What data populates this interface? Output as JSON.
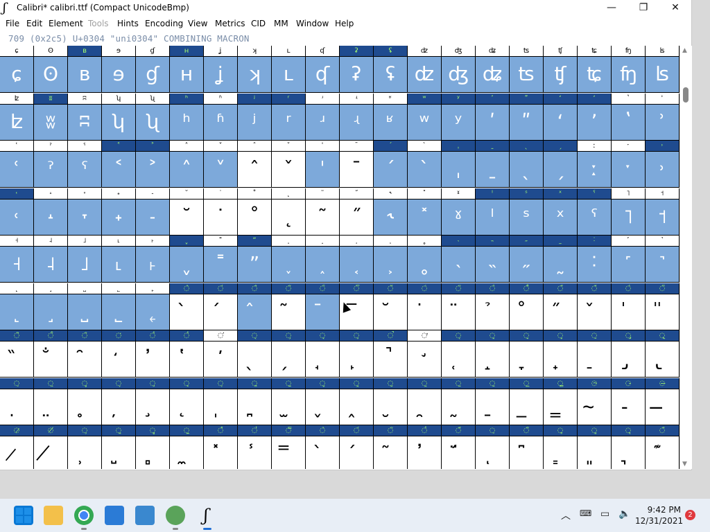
{
  "window": {
    "title": "Calibri*  calibri.ttf (Compact UnicodeBmp)",
    "app_icon_glyph": "ʃ",
    "controls": {
      "minimize": "—",
      "maximize": "❐",
      "close": "✕"
    }
  },
  "menu": [
    "File",
    "Edit",
    "Element",
    "Tools",
    "Hints",
    "Encoding",
    "View",
    "Metrics",
    "CID",
    "MM",
    "Window",
    "Help"
  ],
  "menu_disabled": [
    "Tools"
  ],
  "info_line": "709 (0x2c5) U+0304 \"uni0304\" COMBINING MACRON",
  "rows": [
    {
      "cells": [
        {
          "l": "ɕ",
          "g": "ɕ",
          "s": 1,
          "ls": 0
        },
        {
          "l": "ʘ",
          "g": "ʘ",
          "s": 1,
          "ls": 0
        },
        {
          "l": "ʙ",
          "g": "ʙ",
          "s": 1,
          "ls": 1
        },
        {
          "l": "ɘ",
          "g": "ɘ",
          "s": 1,
          "ls": 0
        },
        {
          "l": "ɠ",
          "g": "ɠ",
          "s": 1,
          "ls": 0
        },
        {
          "l": "ʜ",
          "g": "ʜ",
          "s": 1,
          "ls": 1
        },
        {
          "l": "ʝ",
          "g": "ʝ",
          "s": 1,
          "ls": 0
        },
        {
          "l": "ʞ",
          "g": "ʞ",
          "s": 1,
          "ls": 0
        },
        {
          "l": "ʟ",
          "g": "ʟ",
          "s": 1,
          "ls": 0
        },
        {
          "l": "ʠ",
          "g": "ʠ",
          "s": 1,
          "ls": 0
        },
        {
          "l": "ʡ",
          "g": "ʡ",
          "s": 1,
          "ls": 1
        },
        {
          "l": "ʢ",
          "g": "ʢ",
          "s": 1,
          "ls": 1
        },
        {
          "l": "ʣ",
          "g": "ʣ",
          "s": 1,
          "ls": 0
        },
        {
          "l": "ʤ",
          "g": "ʤ",
          "s": 1,
          "ls": 0
        },
        {
          "l": "ʥ",
          "g": "ʥ",
          "s": 1,
          "ls": 0
        },
        {
          "l": "ʦ",
          "g": "ʦ",
          "s": 1,
          "ls": 0
        },
        {
          "l": "ʧ",
          "g": "ʧ",
          "s": 1,
          "ls": 0
        },
        {
          "l": "ʨ",
          "g": "ʨ",
          "s": 1,
          "ls": 0
        },
        {
          "l": "ʩ",
          "g": "ʩ",
          "s": 1,
          "ls": 0
        },
        {
          "l": "ʪ",
          "g": "ʪ",
          "s": 1,
          "ls": 0
        }
      ]
    },
    {
      "cells": [
        {
          "l": "ʫ",
          "g": "ʫ",
          "s": 1,
          "ls": 0
        },
        {
          "l": "ʬ",
          "g": "ʬ",
          "s": 1,
          "ls": 1
        },
        {
          "l": "ʭ",
          "g": "ʭ",
          "s": 1,
          "ls": 0
        },
        {
          "l": "ʮ",
          "g": "ʮ",
          "s": 1,
          "ls": 0
        },
        {
          "l": "ʯ",
          "g": "ʯ",
          "s": 1,
          "ls": 0
        },
        {
          "l": "ʰ",
          "g": "ʰ",
          "s": 1,
          "ls": 1
        },
        {
          "l": "ʱ",
          "g": "ʱ",
          "s": 1,
          "ls": 0
        },
        {
          "l": "ʲ",
          "g": "ʲ",
          "s": 1,
          "ls": 1
        },
        {
          "l": "ʳ",
          "g": "ʳ",
          "s": 1,
          "ls": 1
        },
        {
          "l": "ʴ",
          "g": "ʴ",
          "s": 1,
          "ls": 0
        },
        {
          "l": "ʵ",
          "g": "ʵ",
          "s": 1,
          "ls": 0
        },
        {
          "l": "ʶ",
          "g": "ʶ",
          "s": 1,
          "ls": 0
        },
        {
          "l": "ʷ",
          "g": "ʷ",
          "s": 1,
          "ls": 1
        },
        {
          "l": "ʸ",
          "g": "ʸ",
          "s": 1,
          "ls": 1
        },
        {
          "l": "ʹ",
          "g": "ʹ",
          "s": 1,
          "ls": 1
        },
        {
          "l": "ʺ",
          "g": "ʺ",
          "s": 1,
          "ls": 1
        },
        {
          "l": "ʻ",
          "g": "ʻ",
          "s": 1,
          "ls": 1
        },
        {
          "l": "ʼ",
          "g": "ʼ",
          "s": 1,
          "ls": 1
        },
        {
          "l": "ʽ",
          "g": "ʽ",
          "s": 1,
          "ls": 0
        },
        {
          "l": "ʾ",
          "g": "ʾ",
          "s": 1,
          "ls": 0
        }
      ]
    },
    {
      "cells": [
        {
          "l": "ʿ",
          "g": "ʿ",
          "s": 1,
          "ls": 0
        },
        {
          "l": "ˀ",
          "g": "ˀ",
          "s": 1,
          "ls": 0
        },
        {
          "l": "ˁ",
          "g": "ˁ",
          "s": 1,
          "ls": 0
        },
        {
          "l": "˂",
          "g": "˂",
          "s": 1,
          "ls": 1
        },
        {
          "l": "˃",
          "g": "˃",
          "s": 1,
          "ls": 1
        },
        {
          "l": "˄",
          "g": "˄",
          "s": 1,
          "ls": 0
        },
        {
          "l": "˅",
          "g": "˅",
          "s": 1,
          "ls": 0
        },
        {
          "l": "ˆ",
          "g": "ˆ",
          "s": 0,
          "ls": 0
        },
        {
          "l": "ˇ",
          "g": "ˇ",
          "s": 0,
          "ls": 0
        },
        {
          "l": "ˈ",
          "g": "ˈ",
          "s": 1,
          "ls": 0
        },
        {
          "l": "ˉ",
          "g": "ˉ",
          "s": 0,
          "ls": 0
        },
        {
          "l": "ˊ",
          "g": "ˊ",
          "s": 1,
          "ls": 1
        },
        {
          "l": "ˋ",
          "g": "ˋ",
          "s": 1,
          "ls": 0
        },
        {
          "l": "ˌ",
          "g": "ˌ",
          "s": 1,
          "ls": 1
        },
        {
          "l": "ˍ",
          "g": "ˍ",
          "s": 1,
          "ls": 1
        },
        {
          "l": "ˎ",
          "g": "ˎ",
          "s": 1,
          "ls": 1
        },
        {
          "l": "ˏ",
          "g": "ˏ",
          "s": 1,
          "ls": 1
        },
        {
          "l": "ː",
          "g": "ː",
          "s": 1,
          "ls": 0
        },
        {
          "l": "ˑ",
          "g": "ˑ",
          "s": 1,
          "ls": 0
        },
        {
          "l": "˒",
          "g": "˒",
          "s": 1,
          "ls": 1
        }
      ]
    },
    {
      "cells": [
        {
          "l": "˓",
          "g": "˓",
          "s": 1,
          "ls": 1
        },
        {
          "l": "˔",
          "g": "˔",
          "s": 1,
          "ls": 0
        },
        {
          "l": "˕",
          "g": "˕",
          "s": 1,
          "ls": 0
        },
        {
          "l": "˖",
          "g": "˖",
          "s": 1,
          "ls": 0
        },
        {
          "l": "˗",
          "g": "˗",
          "s": 1,
          "ls": 0
        },
        {
          "l": "˘",
          "g": "˘",
          "s": 0,
          "ls": 0
        },
        {
          "l": "˙",
          "g": "˙",
          "s": 0,
          "ls": 0
        },
        {
          "l": "˚",
          "g": "˚",
          "s": 0,
          "ls": 0
        },
        {
          "l": "˛",
          "g": "˛",
          "s": 0,
          "ls": 0
        },
        {
          "l": "˜",
          "g": "˜",
          "s": 0,
          "ls": 0
        },
        {
          "l": "˝",
          "g": "˝",
          "s": 0,
          "ls": 0
        },
        {
          "l": "˞",
          "g": "˞",
          "s": 1,
          "ls": 0
        },
        {
          "l": "˟",
          "g": "˟",
          "s": 1,
          "ls": 0
        },
        {
          "l": "ˠ",
          "g": "ˠ",
          "s": 1,
          "ls": 0
        },
        {
          "l": "ˡ",
          "g": "ˡ",
          "s": 1,
          "ls": 1
        },
        {
          "l": "ˢ",
          "g": "ˢ",
          "s": 1,
          "ls": 1
        },
        {
          "l": "ˣ",
          "g": "ˣ",
          "s": 1,
          "ls": 1
        },
        {
          "l": "ˤ",
          "g": "ˤ",
          "s": 1,
          "ls": 1
        },
        {
          "l": "˥",
          "g": "˥",
          "s": 1,
          "ls": 0
        },
        {
          "l": "˦",
          "g": "˦",
          "s": 1,
          "ls": 0
        }
      ]
    },
    {
      "cells": [
        {
          "l": "˧",
          "g": "˧",
          "s": 1,
          "ls": 0
        },
        {
          "l": "˨",
          "g": "˨",
          "s": 1,
          "ls": 0
        },
        {
          "l": "˩",
          "g": "˩",
          "s": 1,
          "ls": 0
        },
        {
          "l": "˪",
          "g": "˪",
          "s": 1,
          "ls": 0
        },
        {
          "l": "˫",
          "g": "˫",
          "s": 1,
          "ls": 0
        },
        {
          "l": "ˬ",
          "g": "ˬ",
          "s": 1,
          "ls": 1
        },
        {
          "l": "˭",
          "g": "˭",
          "s": 1,
          "ls": 0
        },
        {
          "l": "ˮ",
          "g": "ˮ",
          "s": 1,
          "ls": 1
        },
        {
          "l": "˯",
          "g": "˯",
          "s": 1,
          "ls": 0
        },
        {
          "l": "˰",
          "g": "˰",
          "s": 1,
          "ls": 0
        },
        {
          "l": "˱",
          "g": "˱",
          "s": 1,
          "ls": 0
        },
        {
          "l": "˲",
          "g": "˲",
          "s": 1,
          "ls": 0
        },
        {
          "l": "˳",
          "g": "˳",
          "s": 1,
          "ls": 0
        },
        {
          "l": "˴",
          "g": "˴",
          "s": 1,
          "ls": 1
        },
        {
          "l": "˵",
          "g": "˵",
          "s": 1,
          "ls": 1
        },
        {
          "l": "˶",
          "g": "˶",
          "s": 1,
          "ls": 1
        },
        {
          "l": "˷",
          "g": "˷",
          "s": 1,
          "ls": 1
        },
        {
          "l": "˸",
          "g": "˸",
          "s": 1,
          "ls": 1
        },
        {
          "l": "˹",
          "g": "˹",
          "s": 1,
          "ls": 0
        },
        {
          "l": "˺",
          "g": "˺",
          "s": 1,
          "ls": 0
        }
      ]
    },
    {
      "cells": [
        {
          "l": "˻",
          "g": "˻",
          "s": 1,
          "ls": 0
        },
        {
          "l": "˼",
          "g": "˼",
          "s": 1,
          "ls": 0
        },
        {
          "l": "˽",
          "g": "˽",
          "s": 1,
          "ls": 0
        },
        {
          "l": "˾",
          "g": "˾",
          "s": 1,
          "ls": 0
        },
        {
          "l": "˿",
          "g": "˿",
          "s": 1,
          "ls": 0
        },
        {
          "l": "◌̀",
          "g": "̀",
          "s": 0,
          "ls": 1
        },
        {
          "l": "◌́",
          "g": "́",
          "s": 0,
          "ls": 1
        },
        {
          "l": "◌̂",
          "g": "̂",
          "s": 1,
          "ls": 1
        },
        {
          "l": "◌̃",
          "g": "̃",
          "s": 0,
          "ls": 1
        },
        {
          "l": "◌̄",
          "g": "̄",
          "s": 1,
          "ls": 1
        },
        {
          "l": "◌̅",
          "g": "̅",
          "s": 0,
          "ls": 1
        },
        {
          "l": "◌̆",
          "g": "̆",
          "s": 0,
          "ls": 1
        },
        {
          "l": "◌̇",
          "g": "̇",
          "s": 0,
          "ls": 1
        },
        {
          "l": "◌̈",
          "g": "̈",
          "s": 0,
          "ls": 1
        },
        {
          "l": "◌̉",
          "g": "̉",
          "s": 0,
          "ls": 1
        },
        {
          "l": "◌̊",
          "g": "̊",
          "s": 0,
          "ls": 1
        },
        {
          "l": "◌̋",
          "g": "̋",
          "s": 0,
          "ls": 1
        },
        {
          "l": "◌̌",
          "g": "̌",
          "s": 0,
          "ls": 1
        },
        {
          "l": "◌̍",
          "g": "̍",
          "s": 0,
          "ls": 1
        },
        {
          "l": "◌̎",
          "g": "̎",
          "s": 0,
          "ls": 1
        }
      ]
    },
    {
      "cells": [
        {
          "l": "◌̏",
          "g": "̏",
          "s": 0,
          "ls": 1
        },
        {
          "l": "◌̐",
          "g": "̐",
          "s": 0,
          "ls": 1
        },
        {
          "l": "◌̑",
          "g": "̑",
          "s": 0,
          "ls": 1
        },
        {
          "l": "◌̒",
          "g": "̒",
          "s": 0,
          "ls": 1
        },
        {
          "l": "◌̓",
          "g": "̓",
          "s": 0,
          "ls": 1
        },
        {
          "l": "◌̔",
          "g": "̔",
          "s": 0,
          "ls": 1
        },
        {
          "l": "◌̕",
          "g": "̕",
          "s": 0,
          "ls": 0
        },
        {
          "l": "◌̖",
          "g": "̖",
          "s": 0,
          "ls": 1
        },
        {
          "l": "◌̗",
          "g": "̗",
          "s": 0,
          "ls": 1
        },
        {
          "l": "◌̘",
          "g": "̘",
          "s": 0,
          "ls": 1
        },
        {
          "l": "◌̙",
          "g": "̙",
          "s": 0,
          "ls": 1
        },
        {
          "l": "◌̚",
          "g": "̚",
          "s": 0,
          "ls": 1
        },
        {
          "l": "◌̛",
          "g": "̛",
          "s": 0,
          "ls": 0
        },
        {
          "l": "◌̜",
          "g": "̜",
          "s": 0,
          "ls": 1
        },
        {
          "l": "◌̝",
          "g": "̝",
          "s": 0,
          "ls": 1
        },
        {
          "l": "◌̞",
          "g": "̞",
          "s": 0,
          "ls": 1
        },
        {
          "l": "◌̟",
          "g": "̟",
          "s": 0,
          "ls": 1
        },
        {
          "l": "◌̠",
          "g": "̠",
          "s": 0,
          "ls": 1
        },
        {
          "l": "◌̡",
          "g": "̡",
          "s": 0,
          "ls": 1
        },
        {
          "l": "◌̢",
          "g": "̢",
          "s": 0,
          "ls": 1
        }
      ]
    },
    {
      "cells": [
        {
          "l": "◌̣",
          "g": "̣",
          "s": 0,
          "ls": 1
        },
        {
          "l": "◌̤",
          "g": "̤",
          "s": 0,
          "ls": 1
        },
        {
          "l": "◌̥",
          "g": "̥",
          "s": 0,
          "ls": 1
        },
        {
          "l": "◌̦",
          "g": "̦",
          "s": 0,
          "ls": 1
        },
        {
          "l": "◌̧",
          "g": "̧",
          "s": 0,
          "ls": 1
        },
        {
          "l": "◌̨",
          "g": "̨",
          "s": 0,
          "ls": 1
        },
        {
          "l": "◌̩",
          "g": "̩",
          "s": 0,
          "ls": 1
        },
        {
          "l": "◌̪",
          "g": "̪",
          "s": 0,
          "ls": 1
        },
        {
          "l": "◌̫",
          "g": "̫",
          "s": 0,
          "ls": 1
        },
        {
          "l": "◌̬",
          "g": "̬",
          "s": 0,
          "ls": 1
        },
        {
          "l": "◌̭",
          "g": "̭",
          "s": 0,
          "ls": 1
        },
        {
          "l": "◌̮",
          "g": "̮",
          "s": 0,
          "ls": 1
        },
        {
          "l": "◌̯",
          "g": "̯",
          "s": 0,
          "ls": 1
        },
        {
          "l": "◌̰",
          "g": "̰",
          "s": 0,
          "ls": 1
        },
        {
          "l": "◌̱",
          "g": "̱",
          "s": 0,
          "ls": 1
        },
        {
          "l": "◌̲",
          "g": "̲",
          "s": 0,
          "ls": 1
        },
        {
          "l": "◌̳",
          "g": "̳",
          "s": 0,
          "ls": 1
        },
        {
          "l": "◌̴",
          "g": "̴",
          "s": 0,
          "ls": 1
        },
        {
          "l": "◌̵",
          "g": "̵",
          "s": 0,
          "ls": 1
        },
        {
          "l": "◌̶",
          "g": "̶",
          "s": 0,
          "ls": 1
        }
      ]
    },
    {
      "cells": [
        {
          "l": "◌̷",
          "g": "̷",
          "s": 0,
          "ls": 1
        },
        {
          "l": "◌̸",
          "g": "̸",
          "s": 0,
          "ls": 1
        },
        {
          "l": "◌̹",
          "g": "̹",
          "s": 0,
          "ls": 1
        },
        {
          "l": "◌̺",
          "g": "̺",
          "s": 0,
          "ls": 1
        },
        {
          "l": "◌̻",
          "g": "̻",
          "s": 0,
          "ls": 1
        },
        {
          "l": "◌̼",
          "g": "̼",
          "s": 0,
          "ls": 1
        },
        {
          "l": "◌̽",
          "g": "̽",
          "s": 0,
          "ls": 1
        },
        {
          "l": "◌̾",
          "g": "̾",
          "s": 0,
          "ls": 1
        },
        {
          "l": "◌̿",
          "g": "̿",
          "s": 0,
          "ls": 1
        },
        {
          "l": "◌̀",
          "g": "̀",
          "s": 0,
          "ls": 1
        },
        {
          "l": "◌́",
          "g": "́",
          "s": 0,
          "ls": 1
        },
        {
          "l": "◌͂",
          "g": "͂",
          "s": 0,
          "ls": 1
        },
        {
          "l": "◌̓",
          "g": "̓",
          "s": 0,
          "ls": 1
        },
        {
          "l": "◌̈́",
          "g": "̈́",
          "s": 0,
          "ls": 1
        },
        {
          "l": "◌ͅ",
          "g": "ͅ",
          "s": 0,
          "ls": 1
        },
        {
          "l": "◌͆",
          "g": "͆",
          "s": 0,
          "ls": 1
        },
        {
          "l": "◌͇",
          "g": "͇",
          "s": 0,
          "ls": 1
        },
        {
          "l": "◌͈",
          "g": "͈",
          "s": 0,
          "ls": 1
        },
        {
          "l": "◌͉",
          "g": "͉",
          "s": 0,
          "ls": 1
        },
        {
          "l": "◌͊",
          "g": "͊",
          "s": 0,
          "ls": 1
        }
      ]
    }
  ],
  "taskbar": {
    "clock_time": "9:42 PM",
    "clock_date": "12/31/2021",
    "notification_count": "2",
    "tray_chevron": "︿"
  },
  "colors": {
    "selected_label_bg": "#1f4b8f",
    "selected_glyph_bg": "#7da9da",
    "label_fg_selected": "#a6ff6e"
  }
}
